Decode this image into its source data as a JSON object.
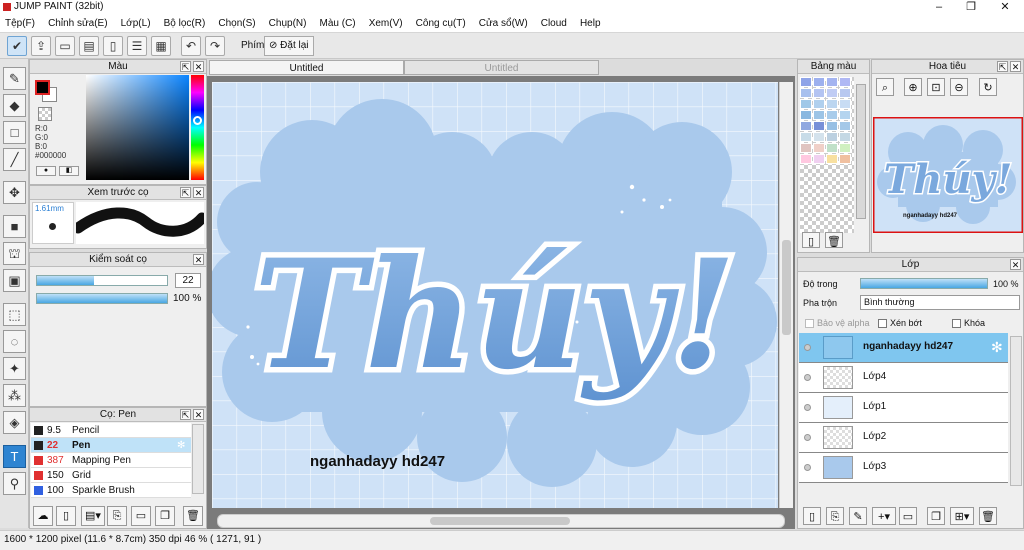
{
  "window": {
    "title": "JUMP PAINT (32bit)",
    "minimize": "–",
    "maximize": "❐",
    "close": "✕"
  },
  "menu": [
    "Tệp(F)",
    "Chỉnh sửa(E)",
    "Lớp(L)",
    "Bộ lọc(R)",
    "Chọn(S)",
    "Chụp(N)",
    "Màu (C)",
    "Xem(V)",
    "Công cụ(T)",
    "Cửa sổ(W)",
    "Cloud",
    "Help"
  ],
  "toolbar": {
    "phim_label": "Phím",
    "reset_label": "Đặt lại"
  },
  "color_panel": {
    "title": "Màu",
    "r": "R:0",
    "g": "G:0",
    "b": "B:0",
    "hex": "#000000"
  },
  "preview_panel": {
    "title": "Xem trước cọ",
    "size": "1.61mm"
  },
  "control_panel": {
    "title": "Kiểm soát cọ",
    "size_value": "22",
    "size_fraction": 0.44,
    "opacity_value": "100 %",
    "opacity_fraction": 1.0
  },
  "brush_panel": {
    "title": "Cọ: Pen",
    "brushes": [
      {
        "size": "9.5",
        "name": "Pencil",
        "color": "#222222"
      },
      {
        "size": "22",
        "name": "Pen",
        "color": "#222222"
      },
      {
        "size": "387",
        "name": "Mapping Pen",
        "color": "#e03030"
      },
      {
        "size": "150",
        "name": "Grid",
        "color": "#e03030"
      },
      {
        "size": "100",
        "name": "Sparkle Brush",
        "color": "#3060e0"
      }
    ]
  },
  "tabs": [
    "Untitled",
    "Untitled"
  ],
  "canvas": {
    "title_text": "Thúy!",
    "signature": "nganhadayy hd247"
  },
  "palette_panel": {
    "title": "Bảng màu"
  },
  "navigator_panel": {
    "title": "Hoa tiêu",
    "title_text": "Thúy!",
    "signature": "nganhadayy hd247"
  },
  "layer_panel": {
    "title": "Lớp",
    "opacity_label": "Độ trong",
    "opacity_value": "100 %",
    "opacity_fraction": 1.0,
    "blend_label": "Pha trộn",
    "blend_value": "Bình thường",
    "protect_alpha": "Bảo vệ alpha",
    "clipping": "Xén bớt",
    "lock": "Khóa",
    "layers": [
      {
        "name": "nganhadayy hd247"
      },
      {
        "name": "Lớp4"
      },
      {
        "name": "Lớp1"
      },
      {
        "name": "Lớp2"
      },
      {
        "name": "Lớp3"
      }
    ]
  },
  "status": {
    "text": "1600 * 1200 pixel   (11.6 * 8.7cm)  350 dpi  46 %  ( 1271, 91 )"
  },
  "colors": {
    "accent": "#2e84d1",
    "canvas_bg": "#cfe2f7",
    "cloud": "#a9c9ec",
    "selection": "#7fc6ef"
  }
}
